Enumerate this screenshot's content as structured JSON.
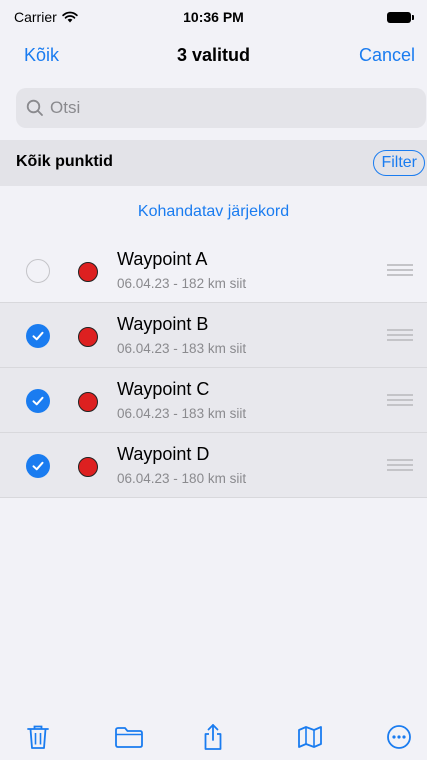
{
  "status_bar": {
    "carrier": "Carrier",
    "time": "10:36 PM"
  },
  "nav": {
    "left": "Kõik",
    "title": "3 valitud",
    "right": "Cancel"
  },
  "search": {
    "placeholder": "Otsi",
    "value": ""
  },
  "section": {
    "title": "Kõik punktid",
    "filter_label": "Filter"
  },
  "sort_order": "Kohandatav järjekord",
  "waypoints": [
    {
      "name": "Waypoint A",
      "subtitle": "06.04.23 - 182 km siit",
      "selected": false,
      "color": "#dd2020"
    },
    {
      "name": "Waypoint B",
      "subtitle": "06.04.23 - 183 km siit",
      "selected": true,
      "color": "#dd2020"
    },
    {
      "name": "Waypoint C",
      "subtitle": "06.04.23 - 183 km siit",
      "selected": true,
      "color": "#dd2020"
    },
    {
      "name": "Waypoint D",
      "subtitle": "06.04.23 - 180 km siit",
      "selected": true,
      "color": "#dd2020"
    }
  ],
  "toolbar": {
    "icons": [
      "trash-icon",
      "folder-icon",
      "share-icon",
      "map-icon",
      "more-icon"
    ]
  },
  "colors": {
    "accent": "#1a7cf0",
    "waypoint": "#dd2020"
  }
}
